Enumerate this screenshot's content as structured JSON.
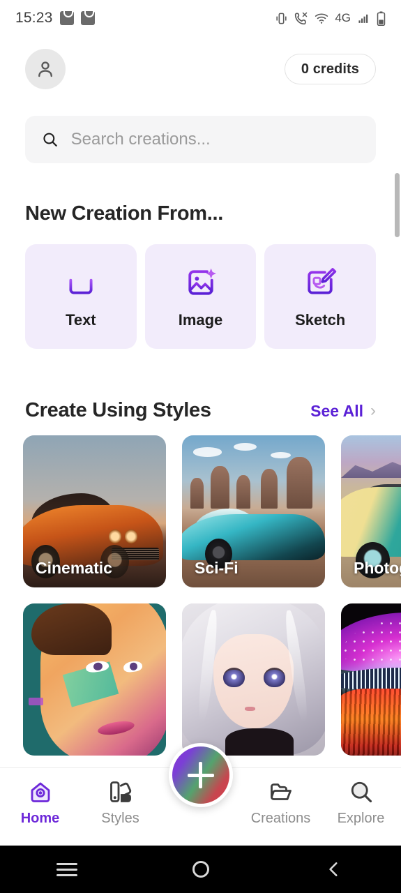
{
  "status_bar": {
    "time": "15:23",
    "left_icons": [
      "mail-bag-icon",
      "mail-bag-icon"
    ],
    "right_icons": [
      "vibrate-icon",
      "call-mute-icon",
      "wifi-icon",
      "signal-icon",
      "battery-icon"
    ],
    "network_label": "4G"
  },
  "header": {
    "avatar_icon": "person-icon",
    "credits_label": "0 credits"
  },
  "search": {
    "icon": "search-icon",
    "placeholder": "Search creations...",
    "value": ""
  },
  "new_creation": {
    "title": "New Creation From...",
    "options": [
      {
        "label": "Text",
        "icon": "text-box-icon"
      },
      {
        "label": "Image",
        "icon": "image-sparkle-icon"
      },
      {
        "label": "Sketch",
        "icon": "sketch-pencil-icon"
      }
    ]
  },
  "styles_section": {
    "title": "Create Using Styles",
    "see_all_label": "See All",
    "chevron": "›",
    "cards": [
      {
        "name": "Cinematic",
        "art": "orange-muscle-car-at-dusk"
      },
      {
        "name": "Sci-Fi",
        "art": "teal-futuristic-car-in-desert"
      },
      {
        "name": "Photography",
        "art": "yellow-teal-classic-car-in-desert"
      },
      {
        "name": "",
        "art": "comic-vector-face-portrait"
      },
      {
        "name": "",
        "art": "anime-girl-white-hair"
      },
      {
        "name": "",
        "art": "neon-mushroom-dome"
      }
    ]
  },
  "bottom_nav": {
    "items": [
      {
        "label": "Home",
        "icon": "home-camera-icon",
        "active": true
      },
      {
        "label": "Styles",
        "icon": "palette-icon",
        "active": false
      },
      {
        "label": "Creations",
        "icon": "folder-icon",
        "active": false
      },
      {
        "label": "Explore",
        "icon": "search-icon",
        "active": false
      }
    ],
    "fab_icon": "plus-icon"
  },
  "android_nav": {
    "recents_icon": "menu-lines-icon",
    "home_icon": "circle-icon",
    "back_icon": "chevron-left-icon"
  },
  "colors": {
    "accent_purple": "#6d28d9",
    "see_all_purple": "#5b21d6",
    "card_purple_bg": "#f2ecfb",
    "search_bg": "#f5f5f6"
  }
}
